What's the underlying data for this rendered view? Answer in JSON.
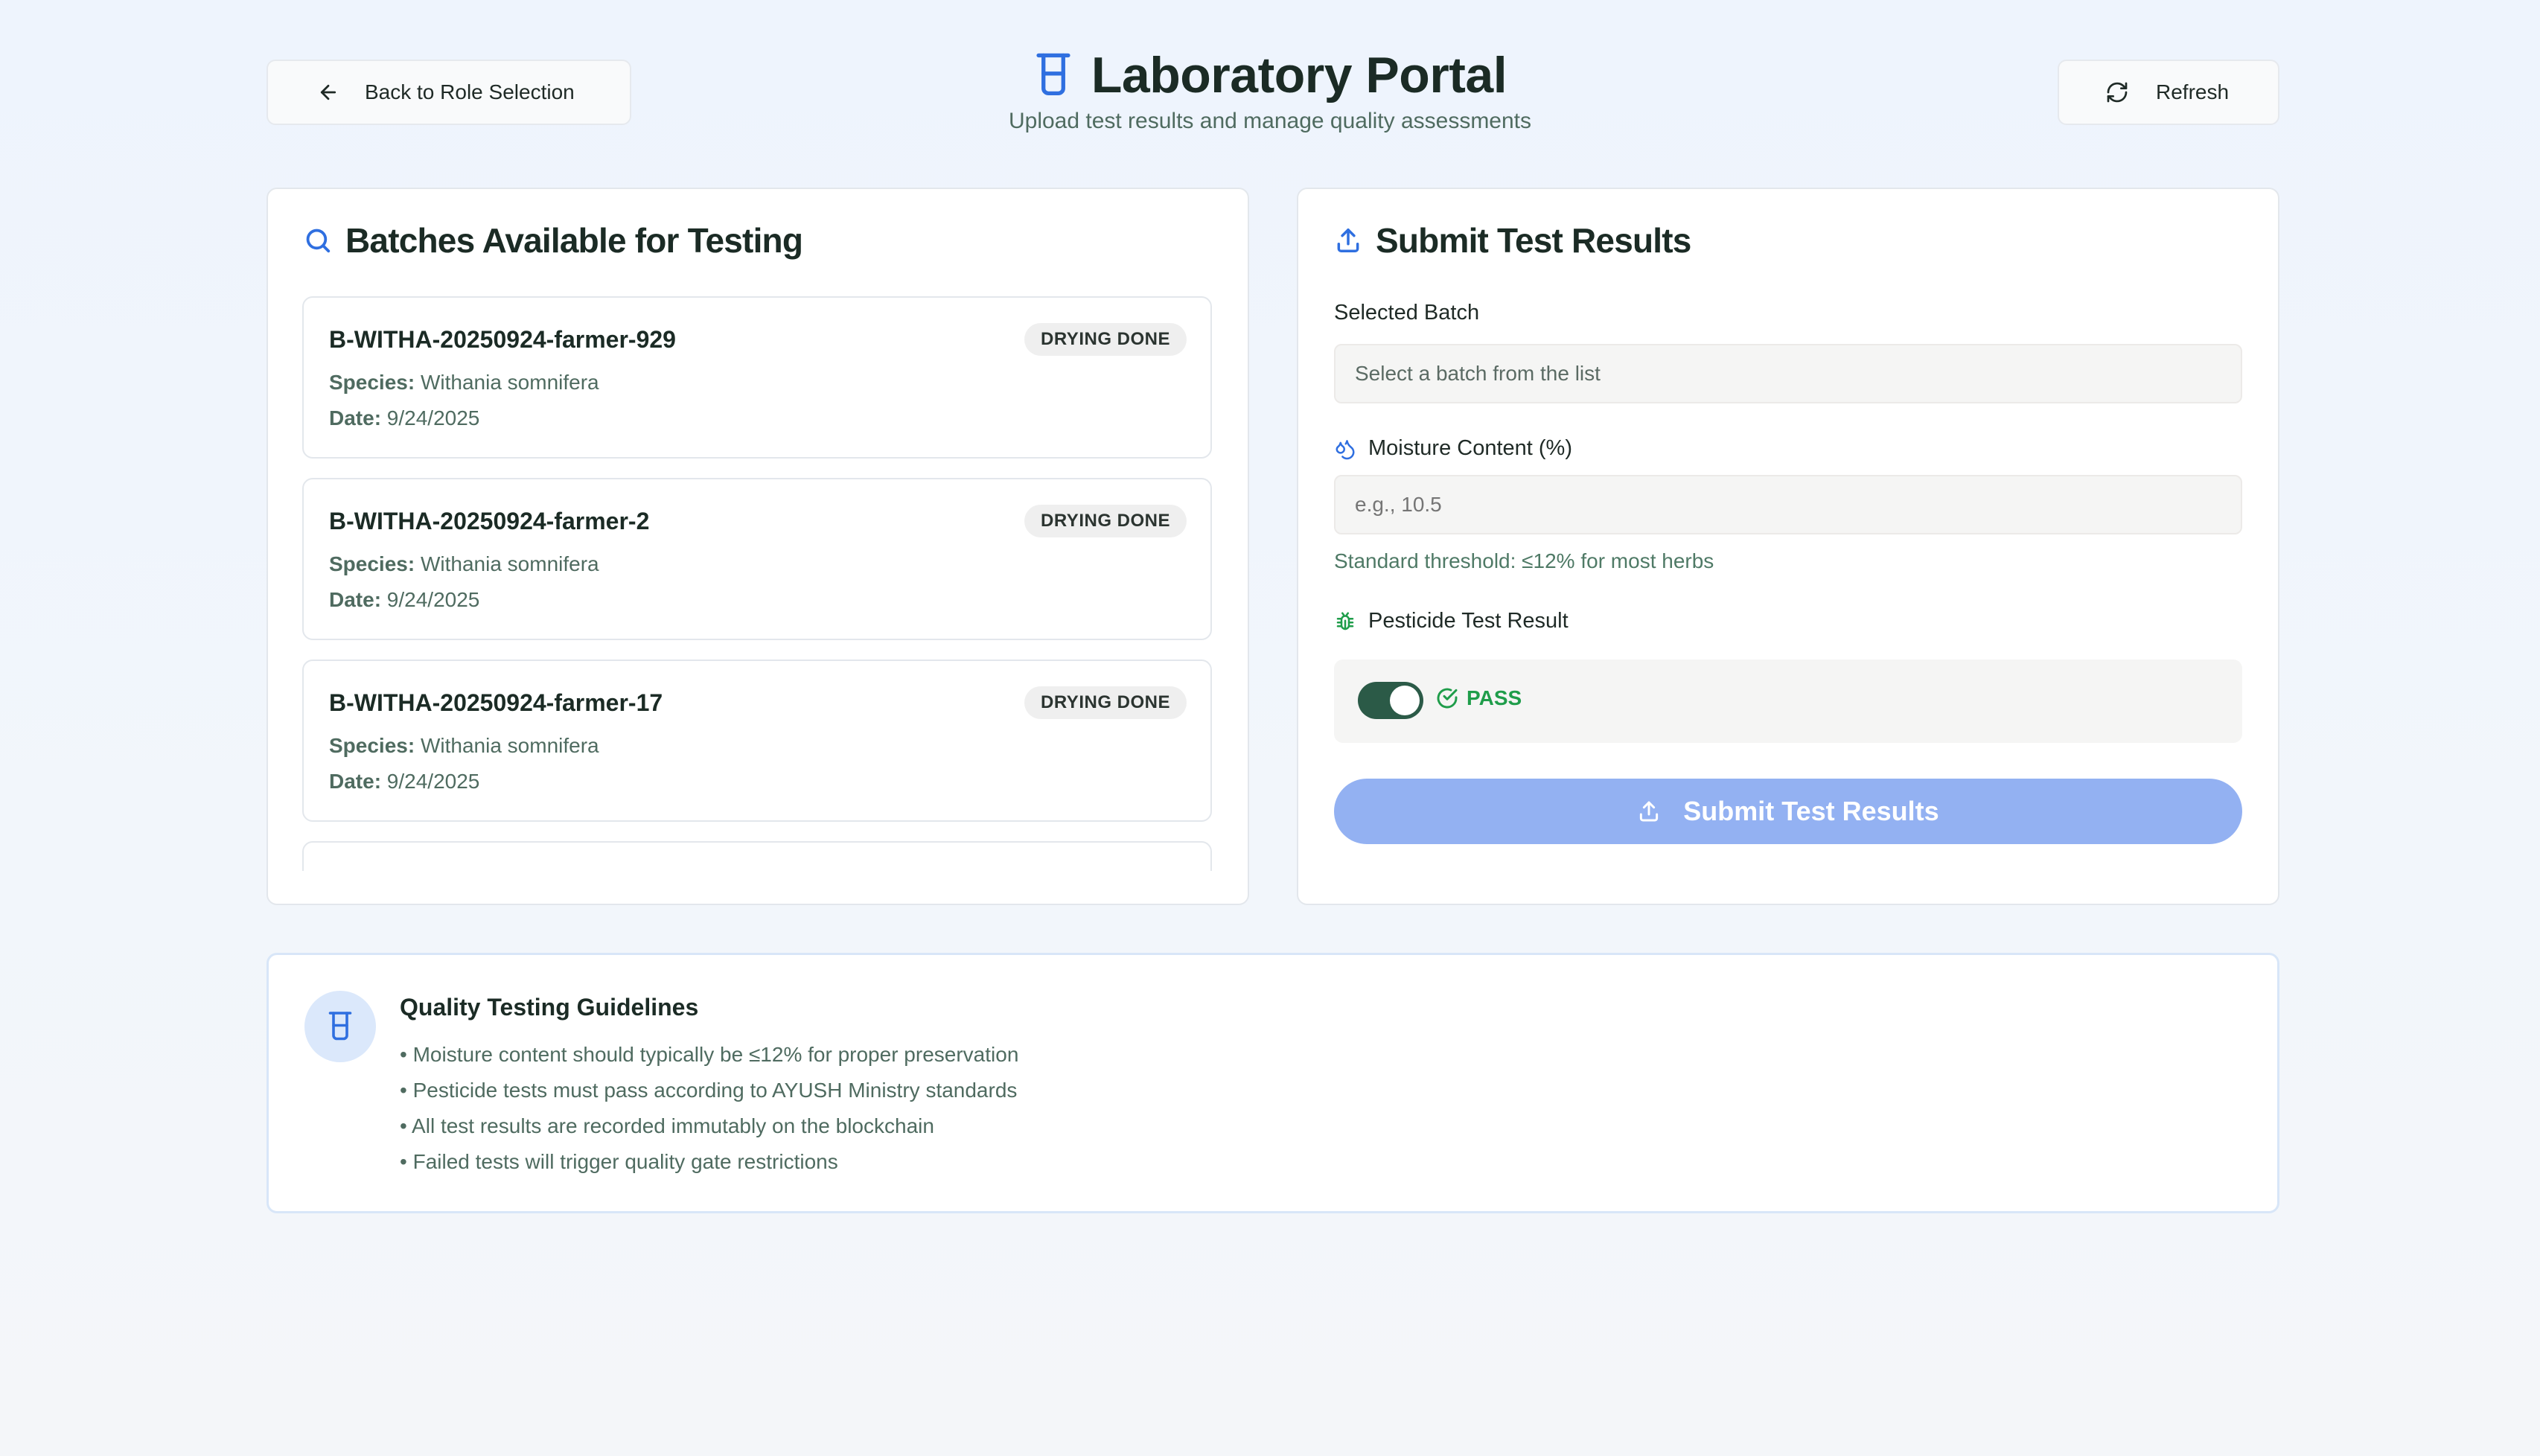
{
  "nav": {
    "back_label": "Back to Role Selection",
    "refresh_label": "Refresh"
  },
  "header": {
    "title": "Laboratory Portal",
    "subtitle": "Upload test results and manage quality assessments"
  },
  "batches_panel": {
    "title": "Batches Available for Testing",
    "species_label": "Species:",
    "date_label": "Date:",
    "items": [
      {
        "id": "B-WITHA-20250924-farmer-929",
        "status": "DRYING DONE",
        "species": "Withania somnifera",
        "date": "9/24/2025"
      },
      {
        "id": "B-WITHA-20250924-farmer-2",
        "status": "DRYING DONE",
        "species": "Withania somnifera",
        "date": "9/24/2025"
      },
      {
        "id": "B-WITHA-20250924-farmer-17",
        "status": "DRYING DONE",
        "species": "Withania somnifera",
        "date": "9/24/2025"
      }
    ]
  },
  "submit_panel": {
    "title": "Submit Test Results",
    "selected_batch_label": "Selected Batch",
    "selected_batch_placeholder": "Select a batch from the list",
    "moisture_label": "Moisture Content (%)",
    "moisture_placeholder": "e.g., 10.5",
    "moisture_hint": "Standard threshold: ≤12% for most herbs",
    "pesticide_label": "Pesticide Test Result",
    "pesticide_value": "PASS",
    "pesticide_toggle_on": true,
    "submit_label": "Submit Test Results"
  },
  "guidelines": {
    "title": "Quality Testing Guidelines",
    "items": [
      "Moisture content should typically be ≤12% for proper preservation",
      "Pesticide tests must pass according to AYUSH Ministry standards",
      "All test results are recorded immutably on the blockchain",
      "Failed tests will trigger quality gate restrictions"
    ]
  },
  "colors": {
    "accent_blue": "#2f6fe0",
    "submit_disabled": "#93b1f2",
    "toggle_on": "#2b5a47",
    "pass_green": "#1f9d4a"
  }
}
